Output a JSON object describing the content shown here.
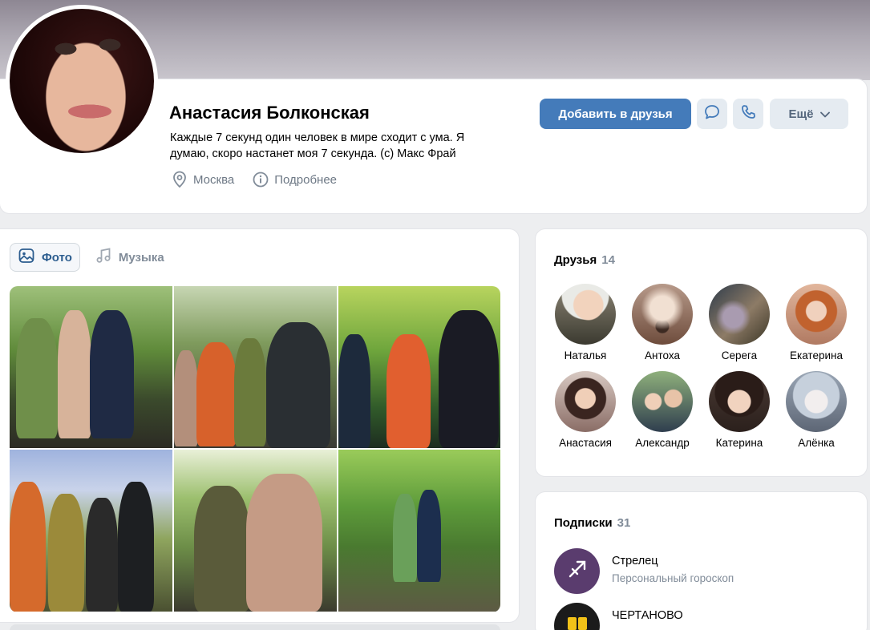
{
  "profile": {
    "name": "Анастасия Болконская",
    "status": "Каждые 7 секунд один человек в мире сходит с ума. Я думаю, скоро настанет моя 7 секунда. (c) Макс Фрай",
    "city": "Москва",
    "details_link": "Подробнее",
    "city_icon": "location-pin-icon",
    "details_icon": "info-icon"
  },
  "actions": {
    "add_friend": "Добавить в друзья",
    "message_icon": "message-icon",
    "call_icon": "phone-icon",
    "more": "Ещё"
  },
  "media": {
    "tabs": [
      {
        "label": "Фото",
        "icon": "photo-icon",
        "active": true
      },
      {
        "label": "Музыка",
        "icon": "music-icon",
        "active": false
      }
    ],
    "photo_count_shown": 6
  },
  "friends": {
    "title": "Друзья",
    "count": "14",
    "items": [
      {
        "name": "Наталья"
      },
      {
        "name": "Антоха"
      },
      {
        "name": "Серега"
      },
      {
        "name": "Екатерина"
      },
      {
        "name": "Анастасия"
      },
      {
        "name": "Александр"
      },
      {
        "name": "Катерина"
      },
      {
        "name": "Алёнка"
      }
    ]
  },
  "subscriptions": {
    "title": "Подписки",
    "count": "31",
    "items": [
      {
        "name": "Стрелец",
        "desc": "Персональный гороскоп"
      },
      {
        "name": "ЧЕРТАНОВО",
        "desc": ""
      }
    ]
  },
  "colors": {
    "primary_button": "#447bba",
    "secondary_button": "#e5ebf1",
    "page_bg": "#edeef0",
    "muted_text": "#818c99"
  }
}
